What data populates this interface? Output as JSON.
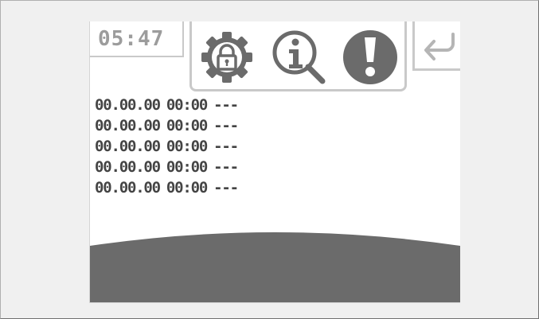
{
  "status": {
    "clock": "05:47"
  },
  "toolbar": {
    "icons": [
      {
        "name": "settings-lock-icon"
      },
      {
        "name": "info-search-icon"
      },
      {
        "name": "alert-icon"
      }
    ],
    "back_icon": "back-arrow-icon"
  },
  "log": {
    "entries": [
      {
        "date": "00.00.00",
        "time": "00:00",
        "value": "---"
      },
      {
        "date": "00.00.00",
        "time": "00:00",
        "value": "---"
      },
      {
        "date": "00.00.00",
        "time": "00:00",
        "value": "---"
      },
      {
        "date": "00.00.00",
        "time": "00:00",
        "value": "---"
      },
      {
        "date": "00.00.00",
        "time": "00:00",
        "value": "---"
      }
    ]
  },
  "colors": {
    "screen_bg": "#ffffff",
    "page_bg": "#f0f0f0",
    "frame_border": "#c9c9c9",
    "icon_dark": "#6b6b6b",
    "bottom_band": "#6b6b6b",
    "clock_text": "#9c9c9c",
    "log_text": "#444444"
  }
}
